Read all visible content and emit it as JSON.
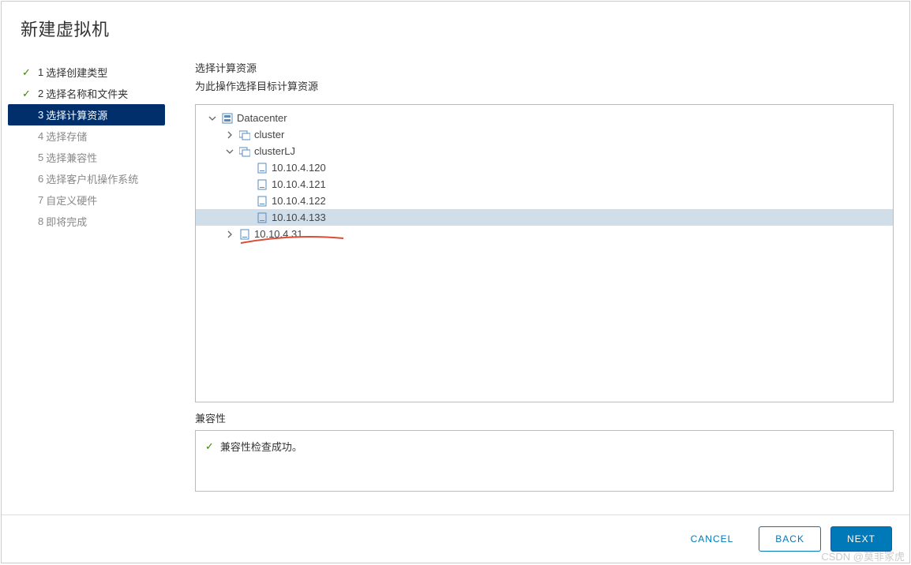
{
  "dialog": {
    "title": "新建虚拟机"
  },
  "steps": [
    {
      "num": "1",
      "label": "选择创建类型",
      "state": "completed"
    },
    {
      "num": "2",
      "label": "选择名称和文件夹",
      "state": "completed"
    },
    {
      "num": "3",
      "label": "选择计算资源",
      "state": "active"
    },
    {
      "num": "4",
      "label": "选择存储",
      "state": "pending"
    },
    {
      "num": "5",
      "label": "选择兼容性",
      "state": "pending"
    },
    {
      "num": "6",
      "label": "选择客户机操作系统",
      "state": "pending"
    },
    {
      "num": "7",
      "label": "自定义硬件",
      "state": "pending"
    },
    {
      "num": "8",
      "label": "即将完成",
      "state": "pending"
    }
  ],
  "main": {
    "heading": "选择计算资源",
    "subtitle": "为此操作选择目标计算资源"
  },
  "tree": {
    "root": {
      "label": "Datacenter",
      "icon": "datacenter"
    },
    "nodes": [
      {
        "label": "cluster",
        "icon": "cluster",
        "expanded": false
      },
      {
        "label": "clusterLJ",
        "icon": "cluster",
        "expanded": true,
        "children": [
          {
            "label": "10.10.4.120",
            "icon": "host"
          },
          {
            "label": "10.10.4.121",
            "icon": "host"
          },
          {
            "label": "10.10.4.122",
            "icon": "host"
          },
          {
            "label": "10.10.4.133",
            "icon": "host",
            "selected": true
          }
        ]
      },
      {
        "label": "10.10.4.31",
        "icon": "host",
        "expanded": false
      }
    ]
  },
  "compat": {
    "title": "兼容性",
    "message": "兼容性检查成功。"
  },
  "buttons": {
    "cancel": "CANCEL",
    "back": "BACK",
    "next": "NEXT"
  },
  "watermark": "CSDN @莫非冢虎"
}
